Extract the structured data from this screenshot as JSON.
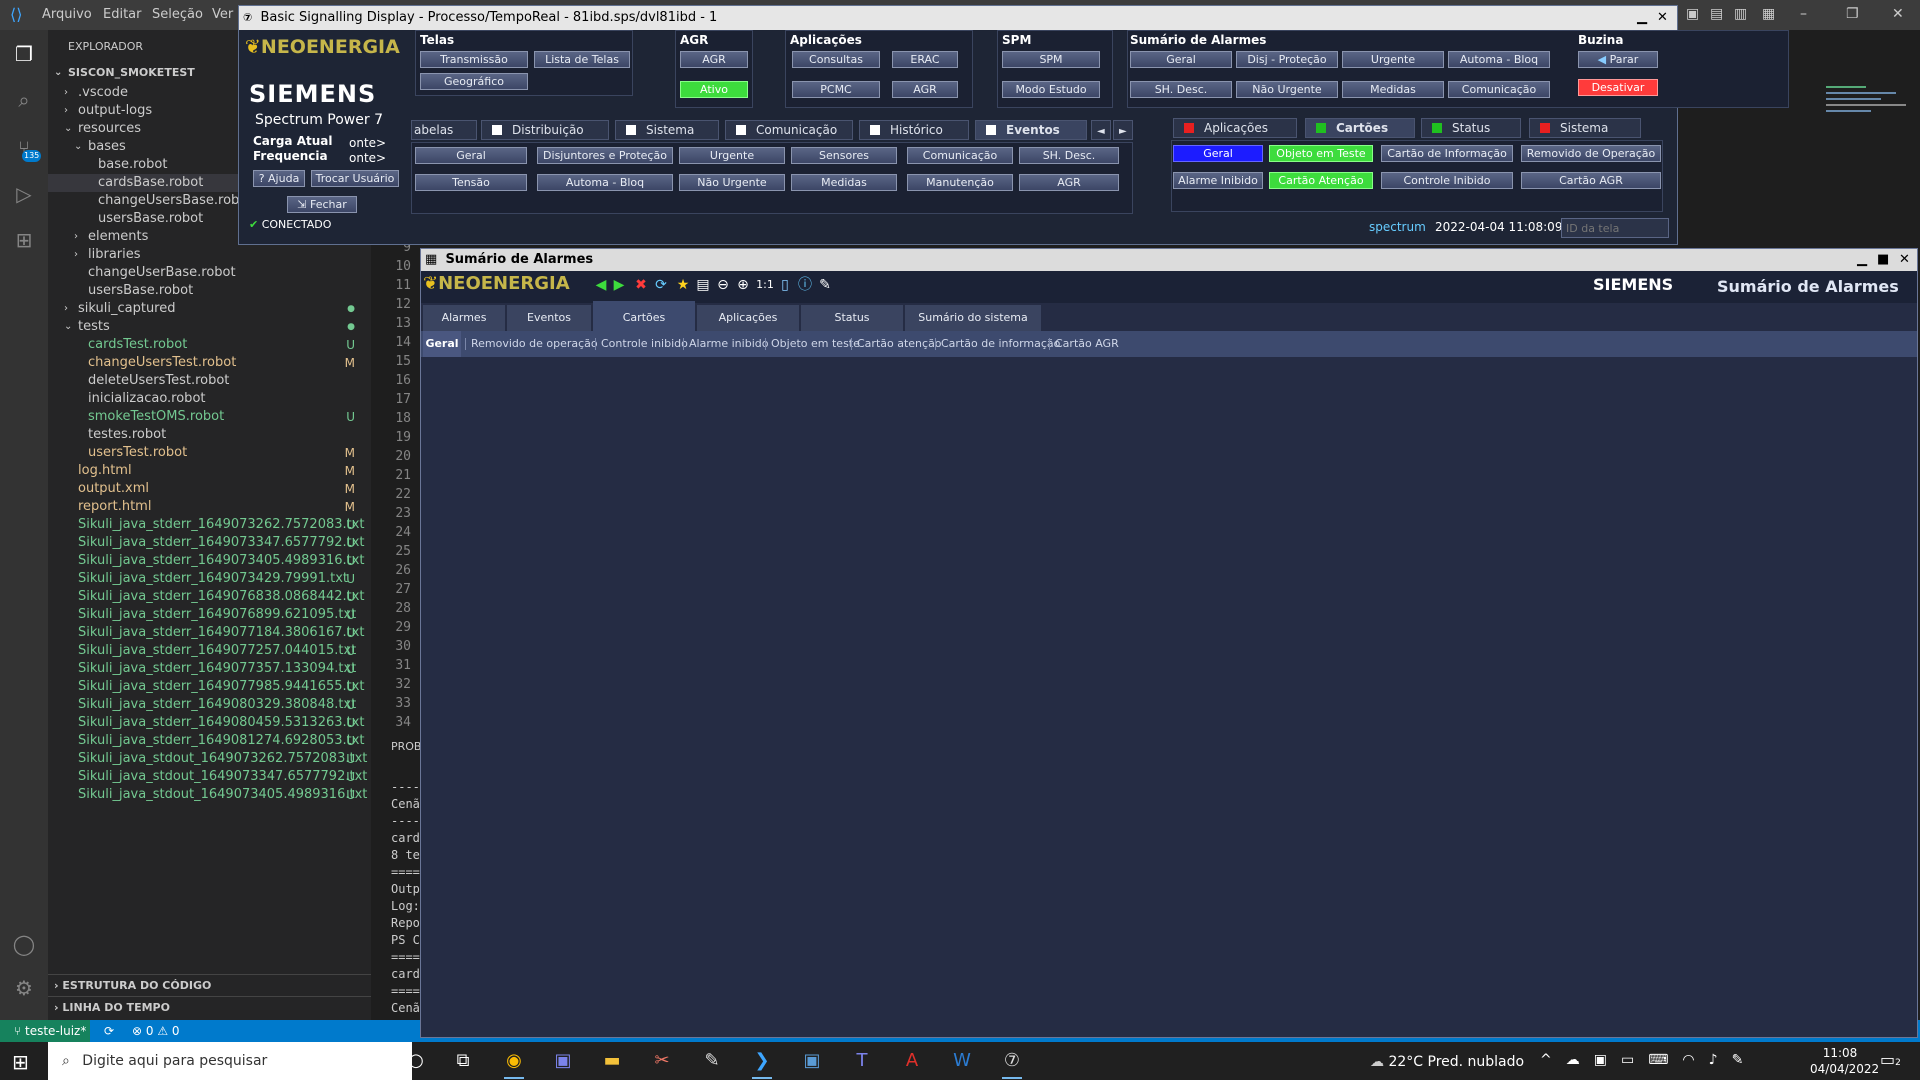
{
  "vscode": {
    "menu": [
      "Arquivo",
      "Editar",
      "Seleção",
      "Ver"
    ],
    "explorer_title": "EXPLORADOR",
    "workspace": "SISCON_SMOKETEST",
    "tree": [
      {
        "label": ".vscode",
        "indent": 1,
        "chev": "›",
        "git": ""
      },
      {
        "label": "output-logs",
        "indent": 1,
        "chev": "›",
        "git": ""
      },
      {
        "label": "resources",
        "indent": 1,
        "chev": "⌄",
        "git": ""
      },
      {
        "label": "bases",
        "indent": 2,
        "chev": "⌄",
        "git": ""
      },
      {
        "label": "base.robot",
        "indent": 3,
        "chev": "",
        "git": ""
      },
      {
        "label": "cardsBase.robot",
        "indent": 3,
        "chev": "",
        "git": "",
        "selected": true
      },
      {
        "label": "changeUsersBase.robot",
        "indent": 3,
        "chev": "",
        "git": ""
      },
      {
        "label": "usersBase.robot",
        "indent": 3,
        "chev": "",
        "git": ""
      },
      {
        "label": "elements",
        "indent": 2,
        "chev": "›",
        "git": "dot"
      },
      {
        "label": "libraries",
        "indent": 2,
        "chev": "›",
        "git": ""
      },
      {
        "label": "changeUserBase.robot",
        "indent": 2,
        "chev": "",
        "git": ""
      },
      {
        "label": "usersBase.robot",
        "indent": 2,
        "chev": "",
        "git": ""
      },
      {
        "label": "sikuli_captured",
        "indent": 1,
        "chev": "›",
        "git": "dot"
      },
      {
        "label": "tests",
        "indent": 1,
        "chev": "⌄",
        "git": "dot"
      },
      {
        "label": "cardsTest.robot",
        "indent": 2,
        "chev": "",
        "git": "U"
      },
      {
        "label": "changeUsersTest.robot",
        "indent": 2,
        "chev": "",
        "git": "M"
      },
      {
        "label": "deleteUsersTest.robot",
        "indent": 2,
        "chev": "",
        "git": ""
      },
      {
        "label": "inicializacao.robot",
        "indent": 2,
        "chev": "",
        "git": ""
      },
      {
        "label": "smokeTestOMS.robot",
        "indent": 2,
        "chev": "",
        "git": "U"
      },
      {
        "label": "testes.robot",
        "indent": 2,
        "chev": "",
        "git": ""
      },
      {
        "label": "usersTest.robot",
        "indent": 2,
        "chev": "",
        "git": "M"
      },
      {
        "label": "log.html",
        "indent": 1,
        "chev": "",
        "git": "M"
      },
      {
        "label": "output.xml",
        "indent": 1,
        "chev": "",
        "git": "M"
      },
      {
        "label": "report.html",
        "indent": 1,
        "chev": "",
        "git": "M"
      },
      {
        "label": "Sikuli_java_stderr_1649073262.7572083.txt",
        "indent": 1,
        "chev": "",
        "git": "U"
      },
      {
        "label": "Sikuli_java_stderr_1649073347.6577792.txt",
        "indent": 1,
        "chev": "",
        "git": "U"
      },
      {
        "label": "Sikuli_java_stderr_1649073405.4989316.txt",
        "indent": 1,
        "chev": "",
        "git": "U"
      },
      {
        "label": "Sikuli_java_stderr_1649073429.79991.txt",
        "indent": 1,
        "chev": "",
        "git": "U"
      },
      {
        "label": "Sikuli_java_stderr_1649076838.0868442.txt",
        "indent": 1,
        "chev": "",
        "git": "U"
      },
      {
        "label": "Sikuli_java_stderr_1649076899.621095.txt",
        "indent": 1,
        "chev": "",
        "git": "U"
      },
      {
        "label": "Sikuli_java_stderr_1649077184.3806167.txt",
        "indent": 1,
        "chev": "",
        "git": "U"
      },
      {
        "label": "Sikuli_java_stderr_1649077257.044015.txt",
        "indent": 1,
        "chev": "",
        "git": "U"
      },
      {
        "label": "Sikuli_java_stderr_1649077357.133094.txt",
        "indent": 1,
        "chev": "",
        "git": "U"
      },
      {
        "label": "Sikuli_java_stderr_1649077985.9441655.txt",
        "indent": 1,
        "chev": "",
        "git": "U"
      },
      {
        "label": "Sikuli_java_stderr_1649080329.380848.txt",
        "indent": 1,
        "chev": "",
        "git": "U"
      },
      {
        "label": "Sikuli_java_stderr_1649080459.5313263.txt",
        "indent": 1,
        "chev": "",
        "git": "U"
      },
      {
        "label": "Sikuli_java_stderr_1649081274.6928053.txt",
        "indent": 1,
        "chev": "",
        "git": "U"
      },
      {
        "label": "Sikuli_java_stdout_1649073262.7572083.txt",
        "indent": 1,
        "chev": "",
        "git": "U"
      },
      {
        "label": "Sikuli_java_stdout_1649073347.6577792.txt",
        "indent": 1,
        "chev": "",
        "git": "U"
      },
      {
        "label": "Sikuli_java_stdout_1649073405.4989316.txt",
        "indent": 1,
        "chev": "",
        "git": "U"
      }
    ],
    "sections": [
      "ESTRUTURA DO CÓDIGO",
      "LINHA DO TEMPO"
    ],
    "line_numbers": [
      "9",
      "10",
      "11",
      "12",
      "13",
      "14",
      "15",
      "16",
      "17",
      "18",
      "19",
      "20",
      "21",
      "22",
      "23",
      "24",
      "25",
      "26",
      "27",
      "28",
      "29",
      "30",
      "31",
      "32",
      "33",
      "34"
    ],
    "panel_label": "PROBI",
    "terminal_lines": [
      "----",
      "Cenã",
      "----",
      "card",
      "8 te",
      "====",
      "Outp",
      "Log:",
      "Repo",
      "PS C",
      "====",
      "card",
      "====",
      "Cenã"
    ],
    "status": {
      "branch": "teste-luiz*",
      "sync": "⟳",
      "errors": "⊗ 0 ⚠ 0"
    },
    "accounts_badge": "135"
  },
  "signalling": {
    "title": "Basic Signalling Display - Processo/TempoReal - 81ibd.sps/dvl81ibd - 1",
    "logo_text": "NEOENERGIA",
    "brand": "SIEMENS",
    "product": "Spectrum Power 7",
    "carga_atual": "Carga Atual",
    "frequencia": "Frequencia",
    "carga_val": "onte>",
    "freq_val": "onte>",
    "ajuda": "Ajuda",
    "trocar": "Trocar Usuário",
    "fechar": "Fechar",
    "connected": "CONECTADO",
    "groups": {
      "telas": {
        "label": "Telas",
        "buttons": [
          "Transmissão",
          "Lista de Telas",
          "Geográfico"
        ]
      },
      "agr": {
        "label": "AGR",
        "buttons": [
          "AGR",
          "Ativo"
        ]
      },
      "aplicacoes": {
        "label": "Aplicações",
        "buttons": [
          "Consultas",
          "ERAC",
          "PCMC",
          "AGR"
        ]
      },
      "spm": {
        "label": "SPM",
        "buttons": [
          "SPM",
          "Modo Estudo"
        ]
      },
      "sumario": {
        "label": "Sumário de Alarmes",
        "buttons": [
          "Geral",
          "Disj - Proteção",
          "Urgente",
          "Automa - Bloq",
          "SH. Desc.",
          "Não Urgente",
          "Medidas",
          "Comunicação"
        ]
      },
      "buzina": {
        "label": "Buzina",
        "buttons": [
          "Parar",
          "Desativar"
        ]
      }
    },
    "left_tabs": [
      "abelas",
      "Distribuição",
      "Sistema",
      "Comunicação",
      "Histórico",
      "Eventos"
    ],
    "left_tab_arrows": [
      "◄",
      "►"
    ],
    "left_row1": [
      "Geral",
      "Disjuntores e Proteção",
      "Urgente",
      "Sensores",
      "Comunicação",
      "SH. Desc."
    ],
    "left_row2": [
      "Tensão",
      "Automa - Bloq",
      "Não Urgente",
      "Medidas",
      "Manutenção",
      "AGR"
    ],
    "right_tabs": [
      "Aplicações",
      "Cartões",
      "Status",
      "Sistema"
    ],
    "right_row1": [
      "Geral",
      "Objeto em Teste",
      "Cartão de Informação",
      "Removido de Operação"
    ],
    "right_row2": [
      "Alarme Inibido",
      "Cartão Atenção",
      "Controle Inibido",
      "Cartão AGR"
    ],
    "footer_user": "spectrum",
    "footer_datetime": "2022-04-04 11:08:09",
    "screen_id_placeholder": "ID da tela"
  },
  "alarm_summary": {
    "title": "Sumário de Alarmes",
    "logo_text": "NEOENERGIA",
    "brand": "SIEMENS",
    "header_title": "Sumário de Alarmes",
    "zoom_label": "1:1",
    "tabs": [
      "Alarmes",
      "Eventos",
      "Cartões",
      "Aplicações",
      "Status",
      "Sumário do sistema"
    ],
    "active_tab": "Cartões",
    "subtabs": [
      "Geral",
      "Removido de operação",
      "Controle inibido",
      "Alarme inibido",
      "Objeto em teste",
      "Cartão atenção",
      "Cartão de informação",
      "Cartão AGR"
    ],
    "active_subtab": "Geral"
  },
  "taskbar": {
    "search_placeholder": "Digite aqui para pesquisar",
    "weather": "22°C  Pred. nublado",
    "time": "11:08",
    "date": "04/04/2022",
    "notif_badge": "2"
  },
  "colors": {
    "accent": "#007acc",
    "ok_green": "#3ddc3d",
    "alarm_red": "#ff3b3b",
    "git_untracked": "#73c991",
    "git_modified": "#e2c08d"
  }
}
